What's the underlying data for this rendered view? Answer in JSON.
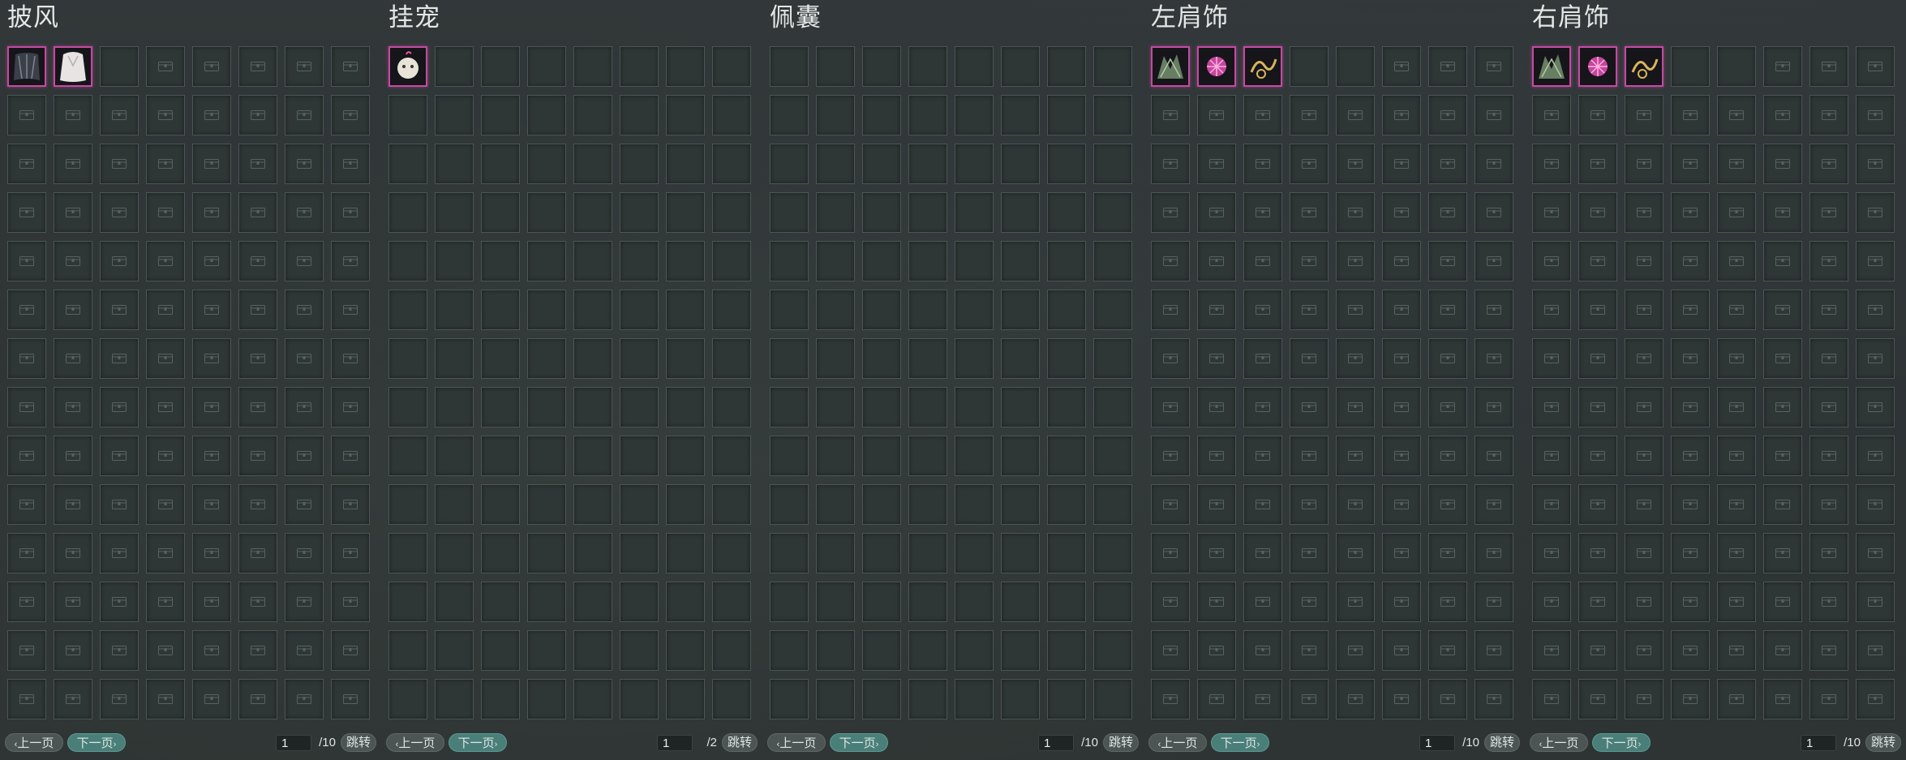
{
  "panels": [
    {
      "title": "披风",
      "unlocked_slots": 3,
      "items": [
        {
          "icon": "dark-cape-icon",
          "color": "#3b3f48"
        },
        {
          "icon": "white-cape-icon",
          "color": "#e8e4e4"
        }
      ],
      "page_current": "1",
      "page_total": "/10"
    },
    {
      "title": "挂宠",
      "unlocked_slots": 112,
      "items": [
        {
          "icon": "white-pet-icon",
          "color": "#e9e2d8"
        }
      ],
      "page_current": "1",
      "page_total": "/2"
    },
    {
      "title": "佩囊",
      "unlocked_slots": 112,
      "items": [],
      "page_current": "1",
      "page_total": "/10"
    },
    {
      "title": "左肩饰",
      "unlocked_slots": 5,
      "items": [
        {
          "icon": "dark-wing-shoulder-icon",
          "color": "#6f8a6a"
        },
        {
          "icon": "pink-flower-shoulder-icon",
          "color": "#e44fb4"
        },
        {
          "icon": "gold-ribbon-shoulder-icon",
          "color": "#d9b45a"
        }
      ],
      "page_current": "1",
      "page_total": "/10"
    },
    {
      "title": "右肩饰",
      "unlocked_slots": 5,
      "items": [
        {
          "icon": "dark-wing-shoulder-icon",
          "color": "#6f8a6a"
        },
        {
          "icon": "pink-flower-shoulder-icon",
          "color": "#e44fb4"
        },
        {
          "icon": "gold-ribbon-shoulder-icon",
          "color": "#d9b45a"
        }
      ],
      "page_current": "1",
      "page_total": "/10"
    }
  ],
  "pager": {
    "prev_label": "上一页",
    "next_label": "下一页",
    "jump_label": "跳转"
  },
  "grid": {
    "rows": 14,
    "cols": 8
  }
}
